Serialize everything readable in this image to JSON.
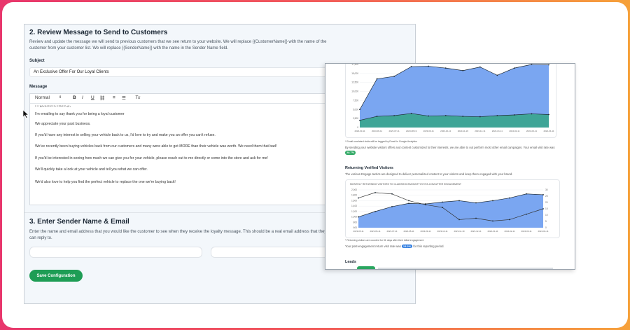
{
  "form": {
    "review_title": "2. Review Message to Send to Customers",
    "review_desc": "Review and update the message we will send to previous customers that we see return to your website. We will replace {{CustomerName}} with the name of the customer from your customer list. We will replace {{SenderName}} with the name in the Sender Name field.",
    "subject_label": "Subject",
    "subject_value": "An Exclusive Offer For Our Loyal Clients",
    "message_label": "Message",
    "toolbar": {
      "format": "Normal",
      "bold": "B",
      "italic": "I",
      "underline": "U",
      "link": "⛓",
      "ordered": "≡",
      "bullet": "☰",
      "clear": "Tx"
    },
    "message_lines": [
      "Hi {{CustomerName}},",
      "I'm emailing to say thank you for being a loyal customer",
      "We appreciate your past business.",
      "If you'd have any interest in selling your vehicle back to us, I'd love to try and make you an offer you can't refuse.",
      "We've recently been buying vehicles back from our customers and many were able to get MORE than their vehicle was worth. We need them that bad!",
      "If you'd be interested in seeing how much we can give you for your vehicle, please reach out to me directly or come into the store and ask for me!",
      "We'll quickly take a look at your vehicle and  tell you what we can offer.",
      "We'd also love to help you find the perfect vehicle to replace the one we're buying back!"
    ],
    "sender_title": "3. Enter Sender Name & Email",
    "sender_desc": "Enter the name and email address that you would like the customer to see when they receive the loyalty message. This should be a real email address that they can reply to.",
    "sender_name_value": "",
    "sender_email_value": "",
    "save_label": "Save Configuration"
  },
  "report": {
    "note1": "* Email unrelated visits will be tagged by Email in Google Analytics",
    "para1": "By sending your website visitors offers and content customized to their interests, we are able to out perform most other email campaigns. Your email visit rate was",
    "rate1": "28.7%",
    "returning_title": "Returning Verified Visitors",
    "returning_desc": "The various Engage tactics are designed to deliver personalized content to your visitors and keep them engaged with your brand.",
    "chart2_title": "MONTHLY RETURNING VISITORS TO CLAWSHOCKMOUNTTOYOTA.COM AFTER ENGAGEMENT",
    "note2": "* Returning visitors are counted for 31 days after their initial engagement",
    "para2_pre": "Your post-engagement return visit rate was",
    "rate2": "13.2%",
    "para2_post": "for this reporting period.",
    "leads_title": "Leads"
  },
  "chart_data": [
    {
      "type": "area",
      "title": "",
      "y_ticks": [
        "17,500",
        "15,000",
        "12,500",
        "10,000",
        "7,500",
        "5,000",
        "2,500",
        "0"
      ],
      "x": [
        "2023-03-11",
        "2023-06-11",
        "2023-07-11",
        "2023-08-19",
        "2023-09-11",
        "2023-10-11",
        "2023-11-19",
        "2023-12-11",
        "2024-01-11",
        "2024-02-11",
        "2024-03-11",
        "2024-04-11"
      ],
      "series": [
        {
          "values": [
            5000,
            13500,
            14200,
            16900,
            17000,
            16500,
            15800,
            16800,
            14500,
            16500,
            17500,
            17400
          ],
          "color": "#6f9ef0"
        },
        {
          "values": [
            2000,
            3100,
            3300,
            3900,
            3200,
            3300,
            3100,
            3000,
            3300,
            3500,
            3800,
            3600
          ],
          "color": "#3aa58f"
        }
      ]
    },
    {
      "type": "area",
      "title": "MONTHLY RETURNING VISITORS TO CLAWSHOCKMOUNTTOYOTA.COM AFTER ENGAGEMENT",
      "y_ticks": [
        "2,000",
        "1,800",
        "1,600",
        "1,400",
        "1,200",
        "1,000",
        "800",
        "600"
      ],
      "y2_ticks": [
        "30",
        "25",
        "20",
        "15",
        "10",
        "5",
        "0"
      ],
      "x": [
        "2023-05-11",
        "2023-06-11",
        "2023-07-11",
        "2023-08-11",
        "2023-09-11",
        "2023-10-11",
        "2023-11-19",
        "2023-12-11",
        "2024-01-11",
        "2024-02-11",
        "2024-03-11",
        "2024-04-11"
      ],
      "series": [
        {
          "values": [
            1000,
            1200,
            1380,
            1500,
            1480,
            1550,
            1600,
            1520,
            1600,
            1700,
            1850,
            1820
          ],
          "color": "#6f9ef0"
        },
        {
          "values": [
            1700,
            1900,
            1850,
            1600,
            1450,
            1350,
            900,
            950,
            850,
            900,
            1100,
            1300
          ],
          "color": "#333333"
        }
      ]
    }
  ]
}
